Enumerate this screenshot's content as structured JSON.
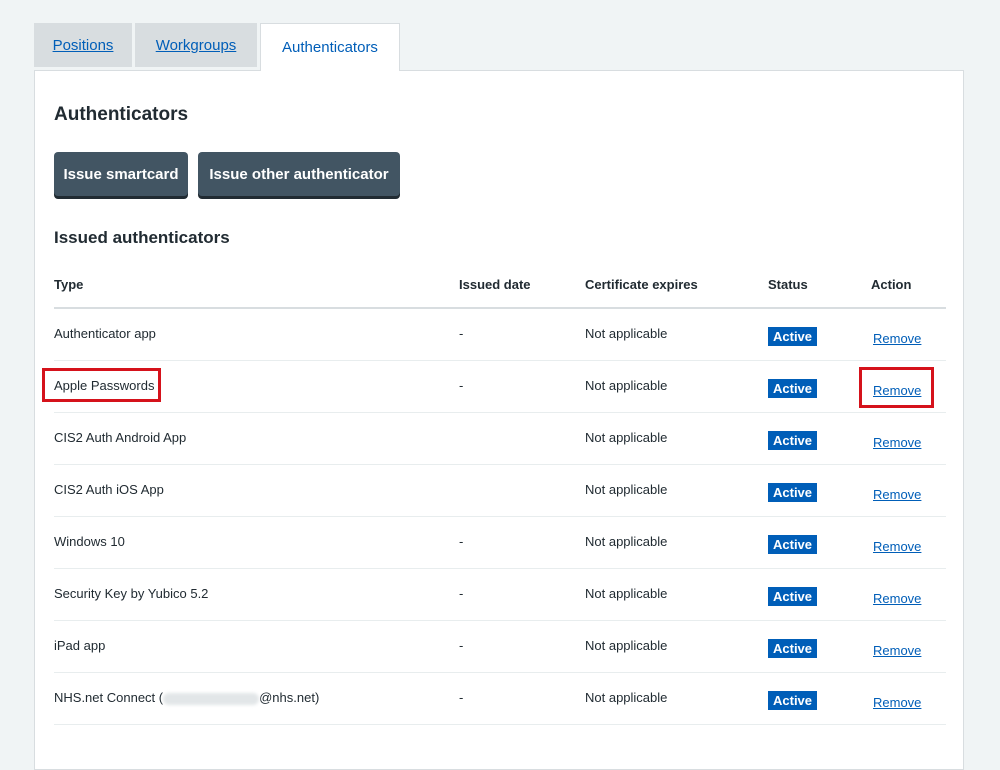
{
  "tabs": [
    {
      "label": "Positions",
      "active": false
    },
    {
      "label": "Workgroups",
      "active": false
    },
    {
      "label": "Authenticators",
      "active": true
    }
  ],
  "panel": {
    "title": "Authenticators",
    "buttons": {
      "issue_smartcard": "Issue smartcard",
      "issue_other": "Issue other authenticator"
    },
    "section_title": "Issued authenticators"
  },
  "table": {
    "headers": [
      "Type",
      "Issued date",
      "Certificate expires",
      "Status",
      "Action"
    ],
    "rows": [
      {
        "type": "Authenticator app",
        "issued": "-",
        "expires": "Not applicable",
        "status": "Active",
        "action": "Remove"
      },
      {
        "type": "Apple Passwords",
        "issued": "-",
        "expires": "Not applicable",
        "status": "Active",
        "action": "Remove"
      },
      {
        "type": "CIS2 Auth Android App",
        "issued": "",
        "expires": "Not applicable",
        "status": "Active",
        "action": "Remove"
      },
      {
        "type": "CIS2 Auth iOS App",
        "issued": "",
        "expires": "Not applicable",
        "status": "Active",
        "action": "Remove"
      },
      {
        "type": "Windows 10",
        "issued": "-",
        "expires": "Not applicable",
        "status": "Active",
        "action": "Remove"
      },
      {
        "type": "Security Key by Yubico 5.2",
        "issued": "-",
        "expires": "Not applicable",
        "status": "Active",
        "action": "Remove"
      },
      {
        "type": "iPad app",
        "issued": "-",
        "expires": "Not applicable",
        "status": "Active",
        "action": "Remove"
      },
      {
        "type_prefix": "NHS.net Connect (",
        "type_suffix": "@nhs.net)",
        "issued": "-",
        "expires": "Not applicable",
        "status": "Active",
        "action": "Remove"
      }
    ]
  },
  "colors": {
    "brand_blue": "#005eb8",
    "button_grey": "#425563",
    "highlight_red": "#d5121b",
    "background": "#f0f4f5"
  }
}
